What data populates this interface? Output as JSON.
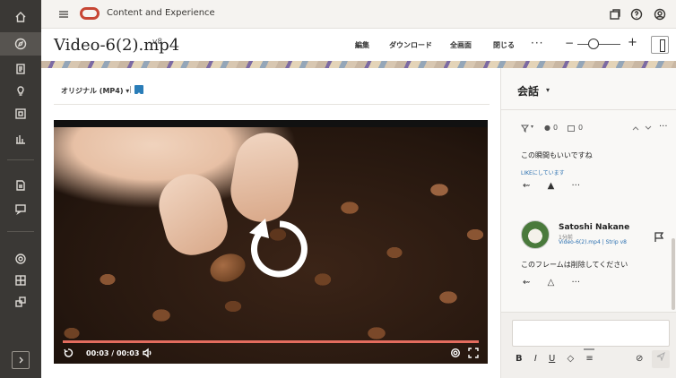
{
  "app": {
    "title": "Content and Experience"
  },
  "document": {
    "name": "Video-6(2).mp4",
    "version": "v8",
    "actions": {
      "edit": "編集",
      "download": "ダウンロード",
      "fullscreen": "全画面",
      "close": "閉じる",
      "more": "···"
    },
    "zoom": {
      "minus": "−",
      "plus": "+",
      "level": 0.25
    }
  },
  "viewer": {
    "rendition_label": "オリジナル (MP4)",
    "rendition_caret": "▾",
    "rendition_separator": "|",
    "video": {
      "current_time": "00:03",
      "duration": "00:03",
      "time_display": "00:03 / 00:03",
      "progress": 1.0
    }
  },
  "panel": {
    "title": "会話",
    "title_caret": "▾",
    "filter": {
      "filter_caret": "▾",
      "count_a": "0",
      "count_b": "0",
      "more": "···"
    },
    "comments": [
      {
        "text": "この瞬間もいいですね",
        "like_status": "LIKEにしています"
      },
      {
        "author": "Satoshi Nakane",
        "time": "1分前",
        "reference": "Video-6(2).mp4 | Strip v8",
        "text": "このフレームは削除してください"
      }
    ],
    "action_more": "···",
    "composer": {
      "bold": "B",
      "italic": "I",
      "underline": "U"
    }
  },
  "colors": {
    "rail_bg": "#3a3835",
    "brand_red": "#c74634",
    "link_blue": "#2a6fb0",
    "progress": "#e36c5e"
  }
}
